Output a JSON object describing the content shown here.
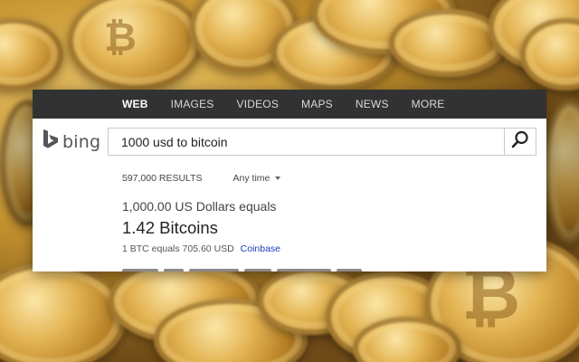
{
  "nav": {
    "items": [
      "WEB",
      "IMAGES",
      "VIDEOS",
      "MAPS",
      "NEWS",
      "MORE"
    ],
    "active": "WEB"
  },
  "logo": {
    "text": "bing",
    "icon": "bing-b-logo-icon"
  },
  "search": {
    "query": "1000 usd to bitcoin",
    "button_icon": "search-icon"
  },
  "filters": {
    "results_count": "597,000 RESULTS",
    "time_filter": "Any time"
  },
  "answer": {
    "line1": "1,000.00 US Dollars equals",
    "line2": "1.42 Bitcoins",
    "rate": "1 BTC equals 705.60 USD",
    "source_link": "Coinbase"
  },
  "colors": {
    "nav_bg": "#323232",
    "link_blue": "#1a3fb8",
    "background_theme": "#c7952f"
  }
}
